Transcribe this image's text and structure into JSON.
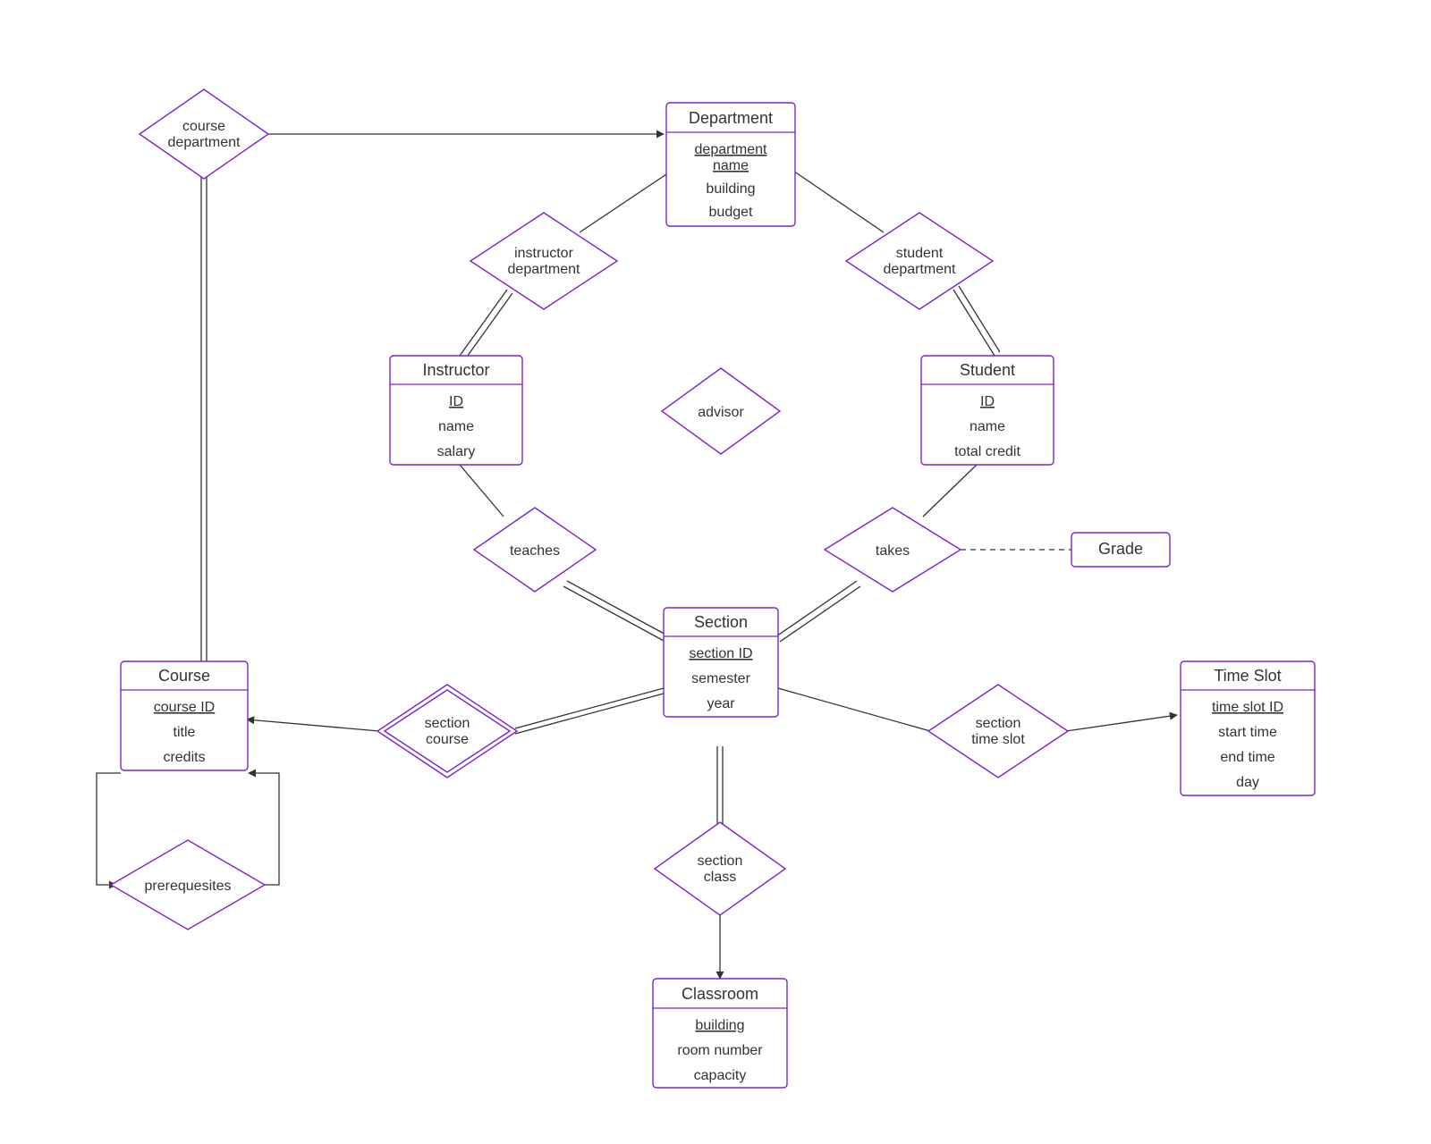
{
  "entities": {
    "department": {
      "title": "Department",
      "key": "department name",
      "attrs": [
        "building",
        "budget"
      ]
    },
    "instructor": {
      "title": "Instructor",
      "key": "ID",
      "attrs": [
        "name",
        "salary"
      ]
    },
    "student": {
      "title": "Student",
      "key": "ID",
      "attrs": [
        "name",
        "total credit"
      ]
    },
    "section": {
      "title": "Section",
      "key": "section ID",
      "attrs": [
        "semester",
        "year"
      ]
    },
    "course": {
      "title": "Course",
      "key": "course ID",
      "attrs": [
        "title",
        "credits"
      ]
    },
    "classroom": {
      "title": "Classroom",
      "key": "building",
      "attrs": [
        "room number",
        "capacity"
      ]
    },
    "timeslot": {
      "title": "Time Slot",
      "key": "time slot ID",
      "attrs": [
        "start time",
        "end time",
        "day"
      ]
    },
    "grade": {
      "title": "Grade"
    }
  },
  "relationships": {
    "course_department": {
      "l1": "course",
      "l2": "department"
    },
    "instructor_department": {
      "l1": "instructor",
      "l2": "department"
    },
    "student_department": {
      "l1": "student",
      "l2": "department"
    },
    "advisor": {
      "l1": "advisor"
    },
    "teaches": {
      "l1": "teaches"
    },
    "takes": {
      "l1": "takes"
    },
    "section_course": {
      "l1": "section",
      "l2": "course"
    },
    "section_class": {
      "l1": "section",
      "l2": "class"
    },
    "section_timeslot": {
      "l1": "section",
      "l2": "time slot"
    },
    "prerequisites": {
      "l1": "prerequesites"
    }
  }
}
